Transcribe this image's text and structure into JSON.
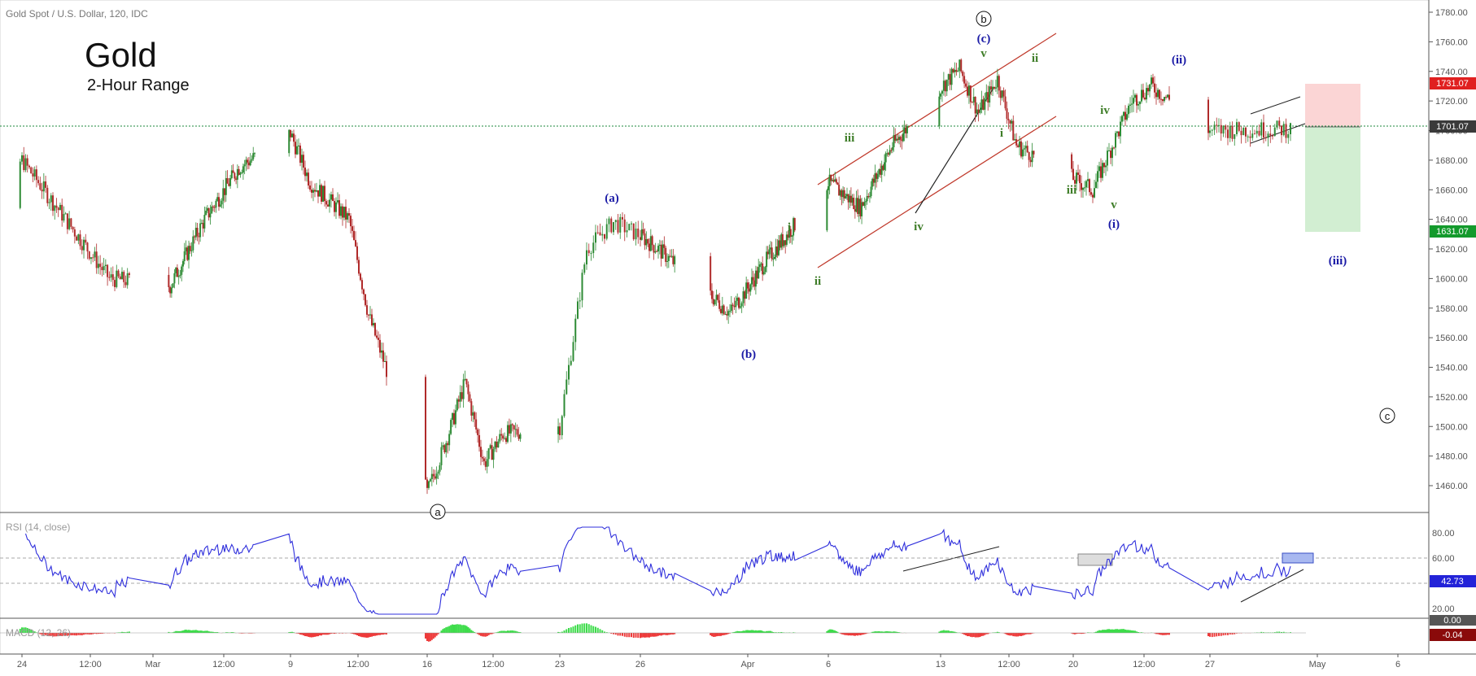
{
  "symbol_header": "Gold Spot / U.S. Dollar, 120, IDC",
  "overlay_title": "Gold",
  "overlay_subtitle": "2-Hour Range",
  "colors": {
    "up": "#26a69a",
    "down": "#ef5350",
    "candle_up": "#2e8b35",
    "candle_down": "#b02a2a",
    "rsi_line": "#2f2fdc",
    "channel": "#c0392b",
    "wave_blue": "#1a1aa6",
    "wave_green": "#3e7d28",
    "current_price_line": "#1b8a3b",
    "target_green": "#cdeccd",
    "stop_red": "#fbd0d0"
  },
  "price_axis": {
    "ticks": [
      "1780.00",
      "1760.00",
      "1740.00",
      "1720.00",
      "1700.00",
      "1680.00",
      "1660.00",
      "1640.00",
      "1620.00",
      "1600.00",
      "1580.00",
      "1560.00",
      "1540.00",
      "1520.00",
      "1500.00",
      "1480.00",
      "1460.00"
    ],
    "label_stop": "1731.07",
    "label_current": "1701.07",
    "label_target": "1631.07"
  },
  "time_axis": [
    "24",
    "12:00",
    "Mar",
    "12:00",
    "9",
    "12:00",
    "16",
    "12:00",
    "23",
    "26",
    "Apr",
    "6",
    "13",
    "12:00",
    "20",
    "12:00",
    "27",
    "May",
    "6"
  ],
  "rsi": {
    "label": "RSI (14, close)",
    "ticks": [
      "80.00",
      "60.00",
      "40.00",
      "20.00"
    ],
    "current": "42.73",
    "upper": 60,
    "lower": 40
  },
  "macd": {
    "label": "MACD (12, 26)",
    "ticks": [
      "0.00"
    ],
    "current": "-0.04"
  },
  "wave_labels": {
    "b_circle": "b",
    "c_circle": "c",
    "a_circle": "a",
    "a_blue": "(a)",
    "b_blue": "(b)",
    "c_blue": "(c)",
    "i_blue": "(i)",
    "ii_blue": "(ii)",
    "iii_blue": "(iii)",
    "g_i1": "i",
    "g_ii1": "ii",
    "g_iii1": "iii",
    "g_iv1": "iv",
    "g_v1": "v",
    "g_i2": "i",
    "g_ii2": "ii",
    "g_iii2": "iii",
    "g_iv2": "iv",
    "g_v2": "v"
  },
  "chart_data": {
    "type": "candlestick",
    "title": "Gold Spot / U.S. Dollar, 120, IDC",
    "timeframe": "2-hour",
    "ylim": [
      1445,
      1785
    ],
    "x_dates": [
      "2020-02-24",
      "2020-03-02",
      "2020-03-09",
      "2020-03-16",
      "2020-03-23",
      "2020-03-26",
      "2020-04-01",
      "2020-04-06",
      "2020-04-13",
      "2020-04-20",
      "2020-04-27",
      "2020-05-01",
      "2020-05-06"
    ],
    "approx_close_path": [
      {
        "date": "2020-02-21",
        "price": 1625
      },
      {
        "date": "2020-02-24",
        "price": 1680
      },
      {
        "date": "2020-02-26",
        "price": 1640
      },
      {
        "date": "2020-02-28",
        "price": 1600
      },
      {
        "date": "2020-03-02",
        "price": 1595
      },
      {
        "date": "2020-03-04",
        "price": 1640
      },
      {
        "date": "2020-03-06",
        "price": 1675
      },
      {
        "date": "2020-03-09",
        "price": 1698
      },
      {
        "date": "2020-03-10",
        "price": 1665
      },
      {
        "date": "2020-03-12",
        "price": 1640
      },
      {
        "date": "2020-03-13",
        "price": 1575
      },
      {
        "date": "2020-03-16",
        "price": 1455
      },
      {
        "date": "2020-03-17",
        "price": 1490
      },
      {
        "date": "2020-03-18",
        "price": 1530
      },
      {
        "date": "2020-03-19",
        "price": 1475
      },
      {
        "date": "2020-03-20",
        "price": 1495
      },
      {
        "date": "2020-03-23",
        "price": 1500
      },
      {
        "date": "2020-03-24",
        "price": 1620
      },
      {
        "date": "2020-03-25",
        "price": 1638
      },
      {
        "date": "2020-03-27",
        "price": 1620
      },
      {
        "date": "2020-03-31",
        "price": 1577
      },
      {
        "date": "2020-04-02",
        "price": 1610
      },
      {
        "date": "2020-04-06",
        "price": 1665
      },
      {
        "date": "2020-04-08",
        "price": 1648
      },
      {
        "date": "2020-04-10",
        "price": 1690
      },
      {
        "date": "2020-04-14",
        "price": 1742
      },
      {
        "date": "2020-04-15",
        "price": 1712
      },
      {
        "date": "2020-04-16",
        "price": 1735
      },
      {
        "date": "2020-04-17",
        "price": 1690
      },
      {
        "date": "2020-04-21",
        "price": 1660
      },
      {
        "date": "2020-04-23",
        "price": 1720
      },
      {
        "date": "2020-04-24",
        "price": 1730
      },
      {
        "date": "2020-04-27",
        "price": 1700
      },
      {
        "date": "2020-04-30",
        "price": 1701
      }
    ],
    "current_price": 1701.07,
    "stop_level": 1731.07,
    "target_level": 1631.07,
    "indicators": [
      {
        "name": "RSI (14, close)",
        "current": 42.73,
        "levels": [
          60,
          40
        ],
        "ylim": [
          15,
          95
        ]
      },
      {
        "name": "MACD (12, 26)",
        "current": -0.04
      }
    ]
  }
}
